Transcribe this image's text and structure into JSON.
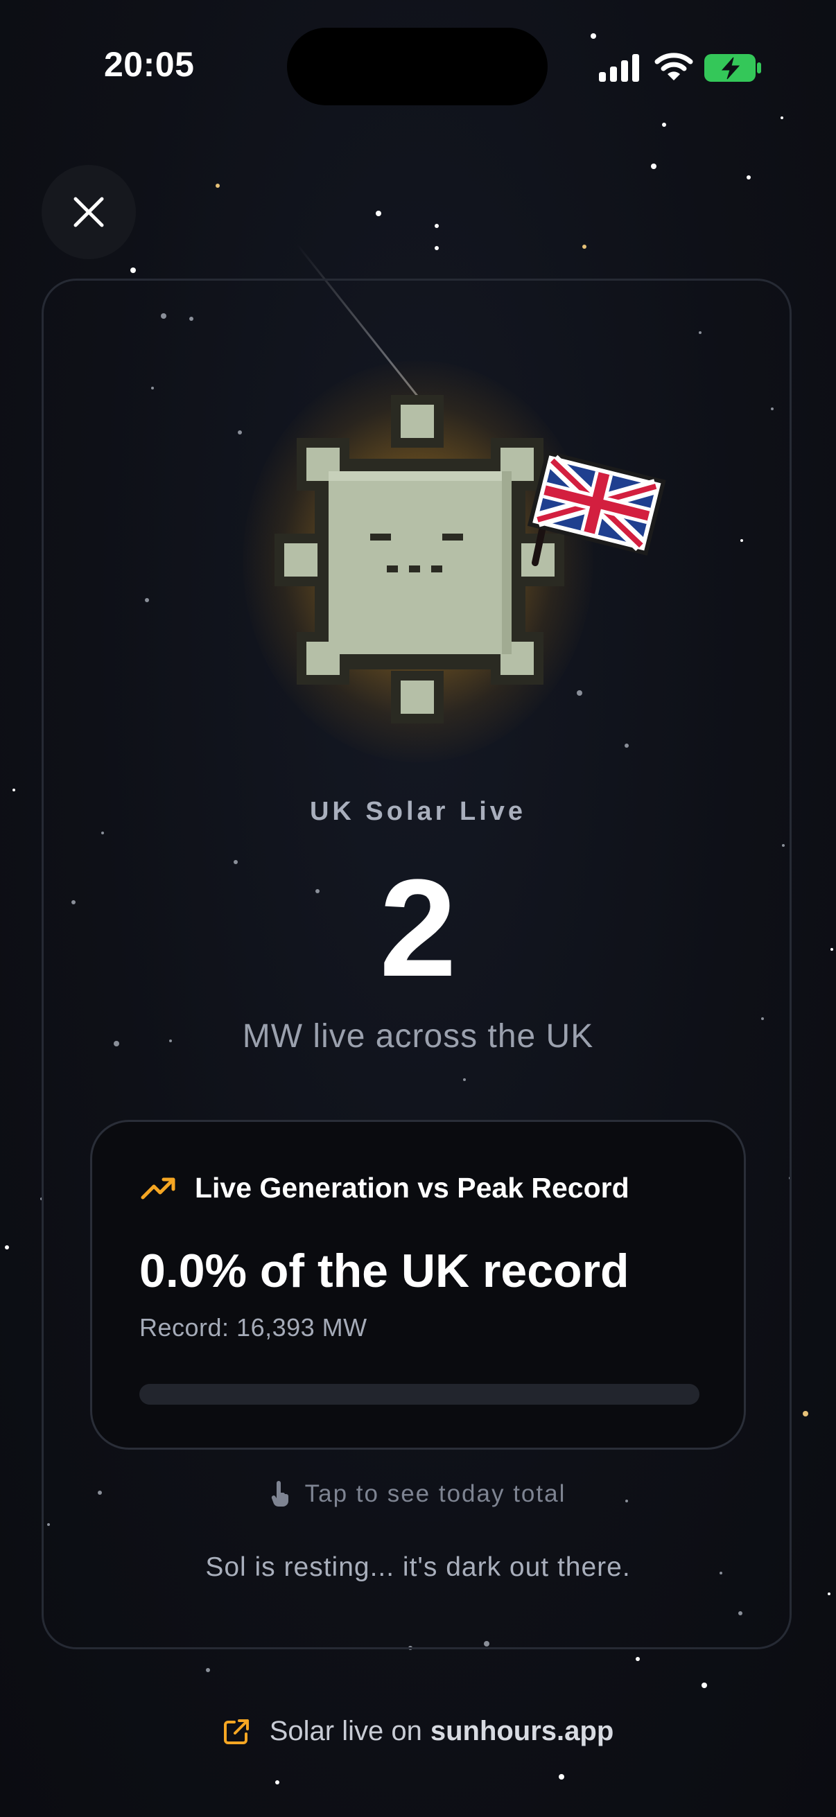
{
  "status_bar": {
    "time": "20:05",
    "battery_color": "#34c759",
    "icons": [
      "signal-icon",
      "wifi-icon",
      "battery-charging-icon"
    ]
  },
  "close_button": {
    "icon": "close-icon"
  },
  "hero": {
    "kicker": "UK Solar Live",
    "value": "2",
    "unit_line": "MW live across the UK",
    "mascot": "sun-mascot-sleeping",
    "flag": "union-jack-flag"
  },
  "record_card": {
    "icon": "trending-up-icon",
    "title": "Live Generation vs Peak Record",
    "percent_text": "0.0% of the UK record",
    "record_text": "Record: 16,393 MW",
    "progress_fraction": 0.0,
    "accent_color": "#f5a623"
  },
  "tap_hint": {
    "icon": "hand-pointer-icon",
    "text": "Tap to see today total"
  },
  "resting_text": "Sol is resting... it's dark out there.",
  "footer": {
    "icon": "external-link-icon",
    "prefix": "Solar live on",
    "site": "sunhours.app"
  }
}
